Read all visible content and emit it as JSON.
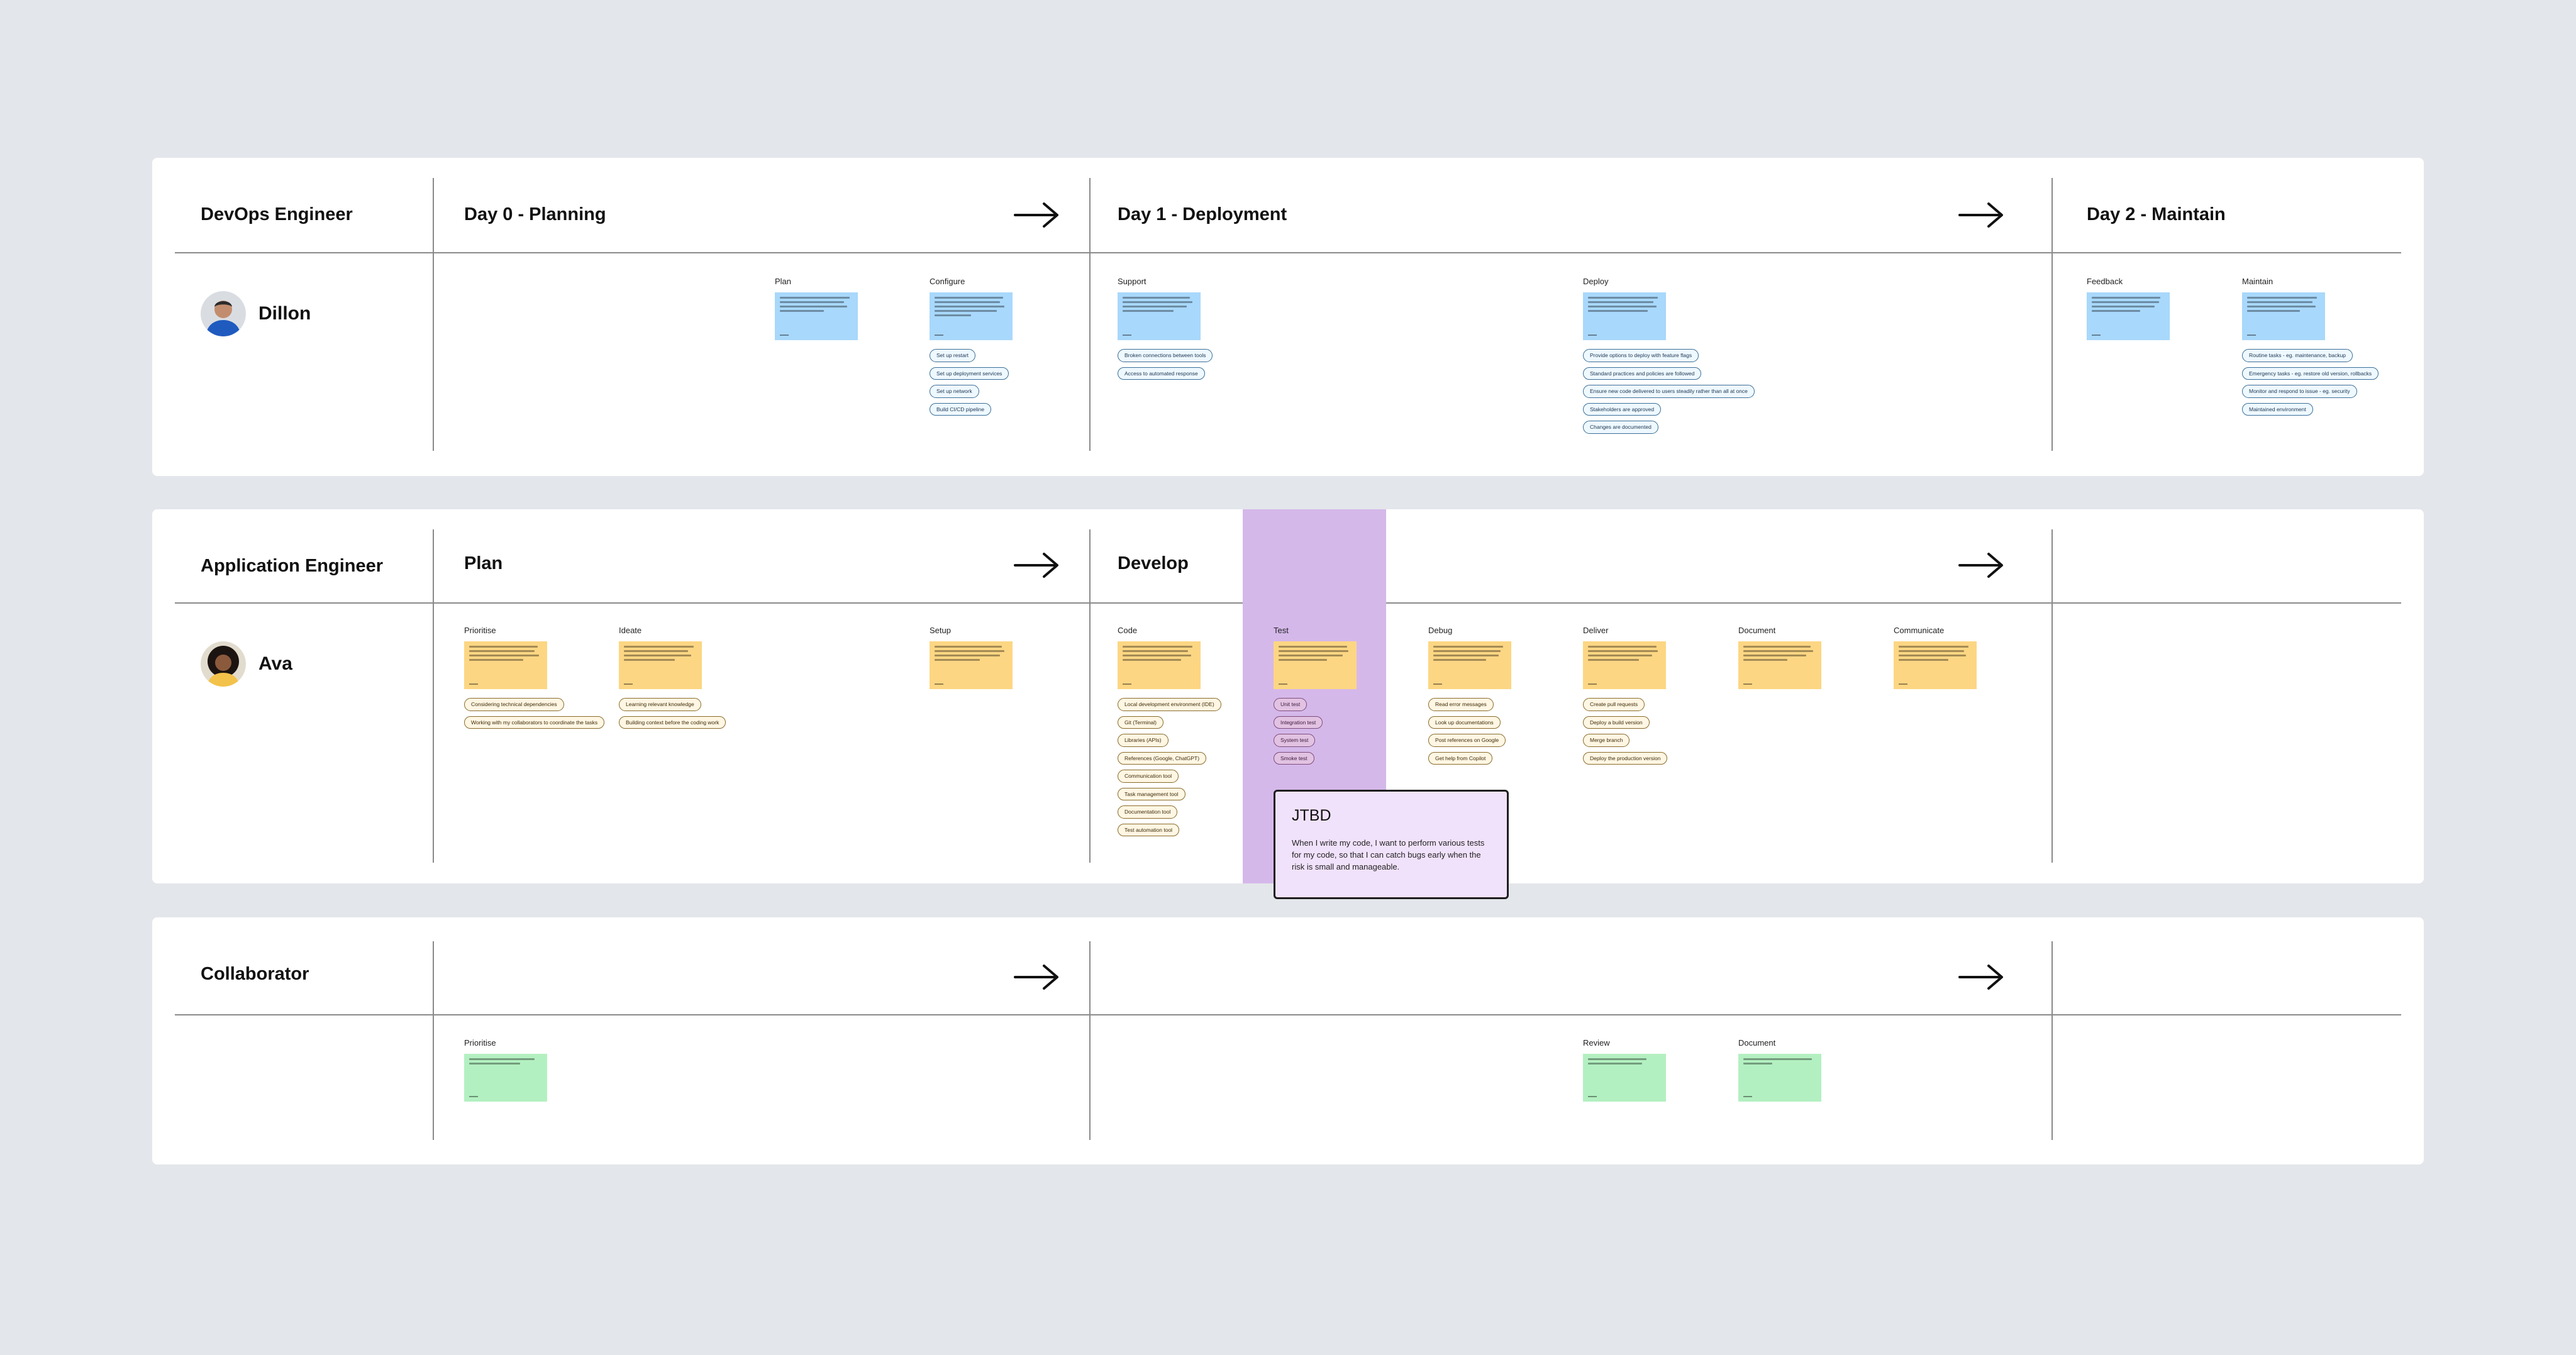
{
  "colors": {
    "background": "#e3e6ea",
    "blue_note": "#a8d8fb",
    "yellow_note": "#fcd683",
    "green_note": "#b3f0c1",
    "highlight": "#d5b8ea",
    "tooltip": "#f1e2fb"
  },
  "rows": [
    {
      "role": "DevOps Engineer",
      "person": "Dillon",
      "phases": [
        "Day 0 - Planning",
        "Day 1 - Deployment",
        "Day 2 - Maintain"
      ],
      "steps": [
        {
          "label": "Plan",
          "chips": []
        },
        {
          "label": "Configure",
          "chips": [
            "Set up restart",
            "Set up deployment services",
            "Set up network",
            "Build CI/CD pipeline"
          ]
        },
        {
          "label": "Support",
          "chips": [
            "Broken connections between tools",
            "Access to automated response"
          ]
        },
        {
          "label": "Deploy",
          "chips": [
            "Provide options to deploy with feature flags",
            "Standard practices and policies are followed",
            "Ensure new code delivered to users steadily rather than all at once",
            "Stakeholders are approved",
            "Changes are documented"
          ]
        },
        {
          "label": "Feedback",
          "chips": []
        },
        {
          "label": "Maintain",
          "chips": [
            "Routine tasks - eg. maintenance, backup",
            "Emergency tasks - eg. restore old version, rollbacks",
            "Monitor and respond to issue - eg. security",
            "Maintained environment"
          ]
        }
      ]
    },
    {
      "role": "Application Engineer",
      "person": "Ava",
      "phases": [
        "Plan",
        "Develop"
      ],
      "steps": [
        {
          "label": "Prioritise",
          "chips": [
            "Considering technical dependencies",
            "Working with my collaborators to coordinate the tasks"
          ]
        },
        {
          "label": "Ideate",
          "chips": [
            "Learning relevant knowledge",
            "Building context before the coding work"
          ]
        },
        {
          "label": "Setup",
          "chips": []
        },
        {
          "label": "Code",
          "chips": [
            "Local development environment (IDE)",
            "Git (Terminal)",
            "Libraries (APIs)",
            "References (Google, ChatGPT)",
            "Communication tool",
            "Task management tool",
            "Documentation tool",
            "Test automation tool"
          ]
        },
        {
          "label": "Test",
          "chips": [
            "Unit test",
            "Integration test",
            "System test",
            "Smoke test"
          ]
        },
        {
          "label": "Debug",
          "chips": [
            "Read error messages",
            "Look up documentations",
            "Post references on Google",
            "Get help from Copilot"
          ]
        },
        {
          "label": "Deliver",
          "chips": [
            "Create pull requests",
            "Deploy a build version",
            "Merge branch",
            "Deploy the production version"
          ]
        },
        {
          "label": "Document",
          "chips": []
        },
        {
          "label": "Communicate",
          "chips": []
        }
      ]
    },
    {
      "role": "Collaborator",
      "steps": [
        {
          "label": "Prioritise"
        },
        {
          "label": "Review"
        },
        {
          "label": "Document"
        }
      ]
    }
  ],
  "tooltip": {
    "title": "JTBD",
    "body": "When I write my code, I want to perform various tests for my code, so that I can catch bugs early when the risk is small and manageable."
  }
}
